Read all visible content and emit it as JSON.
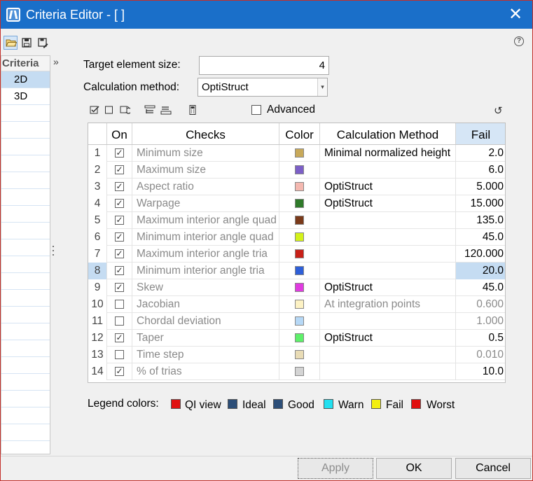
{
  "window": {
    "title": "Criteria Editor - [ ]"
  },
  "toolbar": {
    "icons": [
      "open-folder-icon",
      "save-icon",
      "save-as-icon",
      "help-icon"
    ]
  },
  "criteria_panel": {
    "header": "Criteria",
    "items": [
      {
        "label": "2D",
        "selected": true
      },
      {
        "label": "3D",
        "selected": false
      }
    ]
  },
  "form": {
    "target_label": "Target element size:",
    "target_value": "4",
    "calc_label": "Calculation method:",
    "calc_value": "OptiStruct"
  },
  "table_toolbar": {
    "advanced_label": "Advanced",
    "advanced_checked": false,
    "icons": [
      "check-all-icon",
      "uncheck-all-icon",
      "refresh-icon",
      "expand-icon",
      "collapse-icon",
      "calculator-icon",
      "reset-icon"
    ]
  },
  "table": {
    "headers": {
      "on": "On",
      "checks": "Checks",
      "color": "Color",
      "method": "Calculation Method",
      "fail": "Fail"
    },
    "rows": [
      {
        "num": "1",
        "on": true,
        "check": "Minimum size",
        "color": "#c8a95a",
        "method": "Minimal normalized height",
        "fail": "2.0"
      },
      {
        "num": "2",
        "on": true,
        "check": "Maximum size",
        "color": "#7c5fc7",
        "method": "",
        "fail": "6.0"
      },
      {
        "num": "3",
        "on": true,
        "check": "Aspect ratio",
        "color": "#f4b8b0",
        "method": "OptiStruct",
        "fail": "5.000"
      },
      {
        "num": "4",
        "on": true,
        "check": "Warpage",
        "color": "#2f7a2a",
        "method": "OptiStruct",
        "fail": "15.000"
      },
      {
        "num": "5",
        "on": true,
        "check": "Maximum interior angle quad",
        "color": "#7a3a1a",
        "method": "",
        "fail": "135.0"
      },
      {
        "num": "6",
        "on": true,
        "check": "Minimum interior angle quad",
        "color": "#d4f21a",
        "method": "",
        "fail": "45.0"
      },
      {
        "num": "7",
        "on": true,
        "check": "Maximum interior angle tria",
        "color": "#c82018",
        "method": "",
        "fail": "120.000"
      },
      {
        "num": "8",
        "on": true,
        "check": "Minimum interior angle tria",
        "color": "#2e5fd8",
        "method": "",
        "fail": "20.0",
        "selected": true
      },
      {
        "num": "9",
        "on": true,
        "check": "Skew",
        "color": "#e03be0",
        "method": "OptiStruct",
        "fail": "45.0"
      },
      {
        "num": "10",
        "on": false,
        "check": "Jacobian",
        "color": "#fdf2c4",
        "method": "At integration points",
        "fail": "0.600"
      },
      {
        "num": "11",
        "on": false,
        "check": "Chordal deviation",
        "color": "#b6d8f6",
        "method": "",
        "fail": "1.000"
      },
      {
        "num": "12",
        "on": true,
        "check": "Taper",
        "color": "#5ef06a",
        "method": "OptiStruct",
        "fail": "0.5"
      },
      {
        "num": "13",
        "on": false,
        "check": "Time step",
        "color": "#e9dcb6",
        "method": "",
        "fail": "0.010"
      },
      {
        "num": "14",
        "on": true,
        "check": "% of trias",
        "color": "#d4d4d4",
        "method": "",
        "fail": "10.0"
      }
    ]
  },
  "legend": {
    "label": "Legend colors:",
    "items": [
      {
        "label": "QI view",
        "color": "#e01010"
      },
      {
        "label": "Ideal",
        "color": "#2c4e78"
      },
      {
        "label": "Good",
        "color": "#2c4e78"
      },
      {
        "label": "Warn",
        "color": "#22e0f0"
      },
      {
        "label": "Fail",
        "color": "#f2ee10"
      },
      {
        "label": "Worst",
        "color": "#e01010"
      }
    ]
  },
  "buttons": {
    "apply": "Apply",
    "ok": "OK",
    "cancel": "Cancel"
  }
}
